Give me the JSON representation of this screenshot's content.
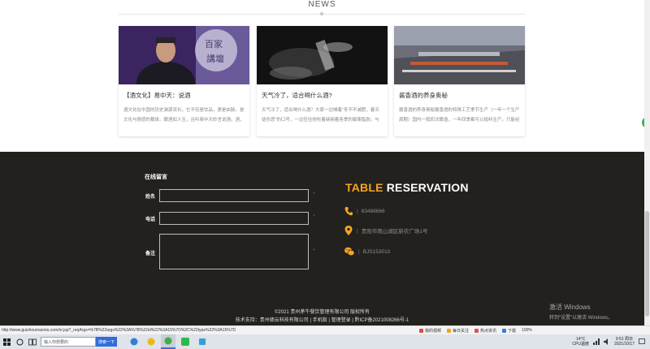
{
  "news": {
    "title": "NEWS",
    "cards": [
      {
        "title": "【酒文化】易中天：说酒",
        "desc": "酒文化在中国的历史渊源流长。它不仅是饮品，更是血脉。是文化与情感的载体。酿酒如人生，且听易中天妙言说酒。酒，则映人们身份等级最重要的表牌中国传..."
      },
      {
        "title": "天气冷了，适合喝什么酒?",
        "desc": "天气冷了，适合喝什么酒？大家一边喊着“冬不不减肥，春天徒伤悲”的口号，一边狂往他吃着碗碗着各季的御寒脂肪。与美食一样，喝酒也讲究个时令，在..."
      },
      {
        "title": "酱香酒的养身奥秘",
        "desc": "酱香酒的养身奥秘酱香酒的特殊工艺季节生产（一年一个生产周期）国内一般四次酿造，一年四季都可以投料生产。只能经过一两次，至多四，五次发酵酒酿取..."
      }
    ]
  },
  "message": {
    "heading": "在线留言",
    "fields": [
      {
        "label": "姓名",
        "value": ""
      },
      {
        "label": "电话",
        "value": ""
      },
      {
        "label": "备注",
        "value": ""
      }
    ],
    "required_mark": "*"
  },
  "reservation": {
    "title_accent": "TABLE",
    "title_rest": "RESERVATION",
    "separator": "|",
    "phone": "83488666",
    "address": "贵阳市观山湖区新农广场1号",
    "wechat": "BJS153010"
  },
  "footer": {
    "copyright": "©2021 贵州茅牛餐饮管理有限公司 版权所有",
    "support": "技术支持：贵州德云科技有限公司 | 手机版 | 管理登录 | 黔ICP备2021008266号-1"
  },
  "watermark": {
    "line1": "激活 Windows",
    "line2": "转到“设置”以激活 Windows。"
  },
  "statusbar": {
    "url": "http://www.guizhoumaoniu.com/nr.jsp?_reqArgs=%7B%22args%22%3A%7B%22id%22%3A15%7D%2C%22type%22%3A15%7D",
    "items": [
      "我的视频",
      "每日关注",
      "热点资讯",
      "下载"
    ],
    "zoom": "100%"
  },
  "taskbar": {
    "search_placeholder": "输入你想要的",
    "search_button": "搜索一下",
    "weather_temp": "14°C",
    "weather_label": "CPU温度",
    "time": "9:51 周日",
    "date": "2021/10/17"
  },
  "colors": {
    "accent_gold": "#f5a623",
    "footer_bg": "#22211e",
    "required_red": "#c0392b"
  }
}
